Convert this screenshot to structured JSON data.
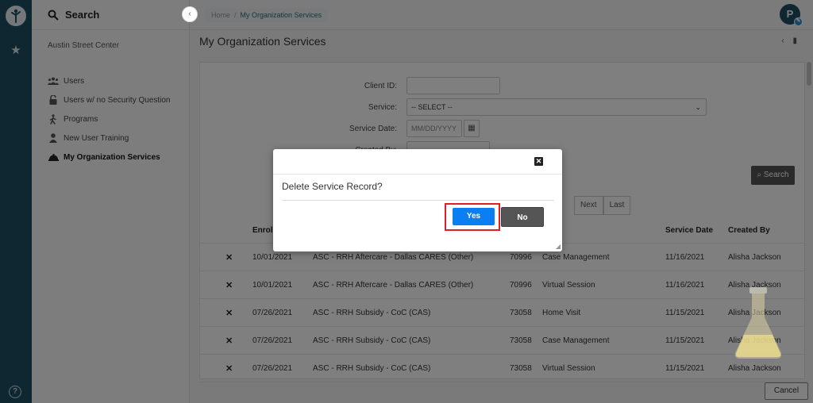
{
  "sidebar": {
    "search_label": "Search",
    "org_name": "Austin Street Center",
    "items": [
      {
        "label": "Users",
        "icon": "users-icon"
      },
      {
        "label": "Users w/ no Security Question",
        "icon": "lock-icon"
      },
      {
        "label": "Programs",
        "icon": "walker-icon"
      },
      {
        "label": "New User Training",
        "icon": "user-icon"
      },
      {
        "label": "My Organization Services",
        "icon": "service-bell-icon"
      }
    ]
  },
  "header": {
    "breadcrumb": {
      "home": "Home",
      "separator": "/",
      "current": "My Organization Services"
    },
    "avatar_letter": "P"
  },
  "page": {
    "title": "My Organization Services"
  },
  "form": {
    "client_id_label": "Client ID:",
    "client_id_value": "",
    "service_label": "Service:",
    "service_value": "-- SELECT --",
    "service_date_label": "Service Date:",
    "service_date_placeholder": "MM/DD/YYYY",
    "created_by_label": "Created By:",
    "created_by_value": "",
    "search_button": "Search"
  },
  "pager": {
    "next": "Next",
    "last": "Last"
  },
  "table": {
    "headers": [
      "Enroll",
      "Service Date",
      "Created By"
    ],
    "rows": [
      {
        "enroll": "10/01/2021",
        "program": "ASC - RRH Aftercare - Dallas CARES (Other)",
        "id": "70996",
        "service": "Case Management",
        "date": "11/16/2021",
        "created_by": "Alisha Jackson"
      },
      {
        "enroll": "10/01/2021",
        "program": "ASC - RRH Aftercare - Dallas CARES (Other)",
        "id": "70996",
        "service": "Virtual Session",
        "date": "11/16/2021",
        "created_by": "Alisha Jackson"
      },
      {
        "enroll": "07/26/2021",
        "program": "ASC - RRH Subsidy - CoC (CAS)",
        "id": "73058",
        "service": "Home Visit",
        "date": "11/15/2021",
        "created_by": "Alisha Jackson"
      },
      {
        "enroll": "07/26/2021",
        "program": "ASC - RRH Subsidy - CoC (CAS)",
        "id": "73058",
        "service": "Case Management",
        "date": "11/15/2021",
        "created_by": "Alisha Jackson"
      },
      {
        "enroll": "07/26/2021",
        "program": "ASC - RRH Subsidy - CoC (CAS)",
        "id": "73058",
        "service": "Virtual Session",
        "date": "11/15/2021",
        "created_by": "Alisha Jackson"
      }
    ]
  },
  "footer": {
    "cancel": "Cancel"
  },
  "modal": {
    "message": "Delete Service Record?",
    "yes": "Yes",
    "no": "No"
  },
  "colors": {
    "rail": "#1f4f63",
    "primary_button": "#0b7ff2",
    "highlight": "#e02020",
    "dark_button": "#555555"
  }
}
